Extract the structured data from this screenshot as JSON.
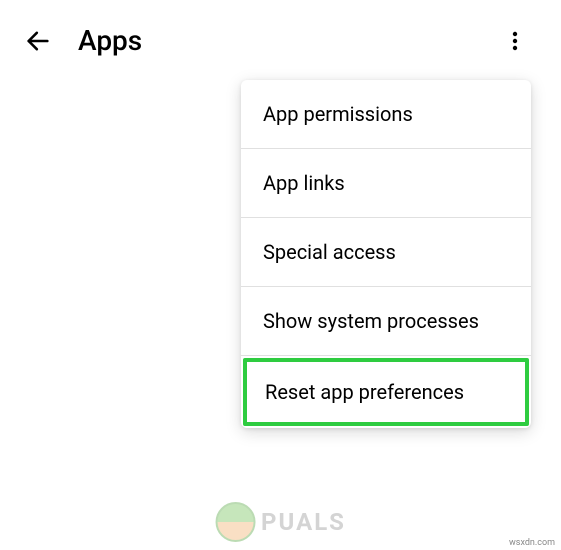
{
  "header": {
    "title": "Apps"
  },
  "menu": {
    "items": [
      {
        "label": "App permissions",
        "highlighted": false
      },
      {
        "label": "App links",
        "highlighted": false
      },
      {
        "label": "Special access",
        "highlighted": false
      },
      {
        "label": "Show system processes",
        "highlighted": false
      },
      {
        "label": "Reset app preferences",
        "highlighted": true
      }
    ]
  },
  "watermark": {
    "text": "PUALS"
  },
  "source": {
    "text": "wsxdn.com"
  }
}
